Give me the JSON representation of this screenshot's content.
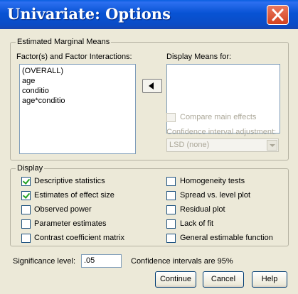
{
  "window": {
    "title": "Univariate: Options"
  },
  "emm": {
    "legend": "Estimated Marginal Means",
    "factors_label": "Factor(s) and Factor Interactions:",
    "factors": [
      "(OVERALL)",
      "age",
      "conditio",
      "age*conditio"
    ],
    "display_label": "Display Means for:",
    "compare_label": "Compare main effects",
    "ci_adjust_label": "Confidence interval adjustment:",
    "ci_adjust_value": "LSD (none)"
  },
  "display": {
    "legend": "Display",
    "options": [
      {
        "label": "Descriptive statistics",
        "checked": true
      },
      {
        "label": "Estimates of effect size",
        "checked": true
      },
      {
        "label": "Observed power",
        "checked": false
      },
      {
        "label": "Parameter estimates",
        "checked": false
      },
      {
        "label": "Contrast coefficient matrix",
        "checked": false
      },
      {
        "label": "Homogeneity tests",
        "checked": false
      },
      {
        "label": "Spread vs. level plot",
        "checked": false
      },
      {
        "label": "Residual plot",
        "checked": false
      },
      {
        "label": "Lack of fit",
        "checked": false
      },
      {
        "label": "General estimable function",
        "checked": false
      }
    ]
  },
  "significance": {
    "label": "Significance level:",
    "value": ".05",
    "ci_text": "Confidence intervals are 95%"
  },
  "buttons": {
    "continue": "Continue",
    "cancel": "Cancel",
    "help": "Help"
  }
}
